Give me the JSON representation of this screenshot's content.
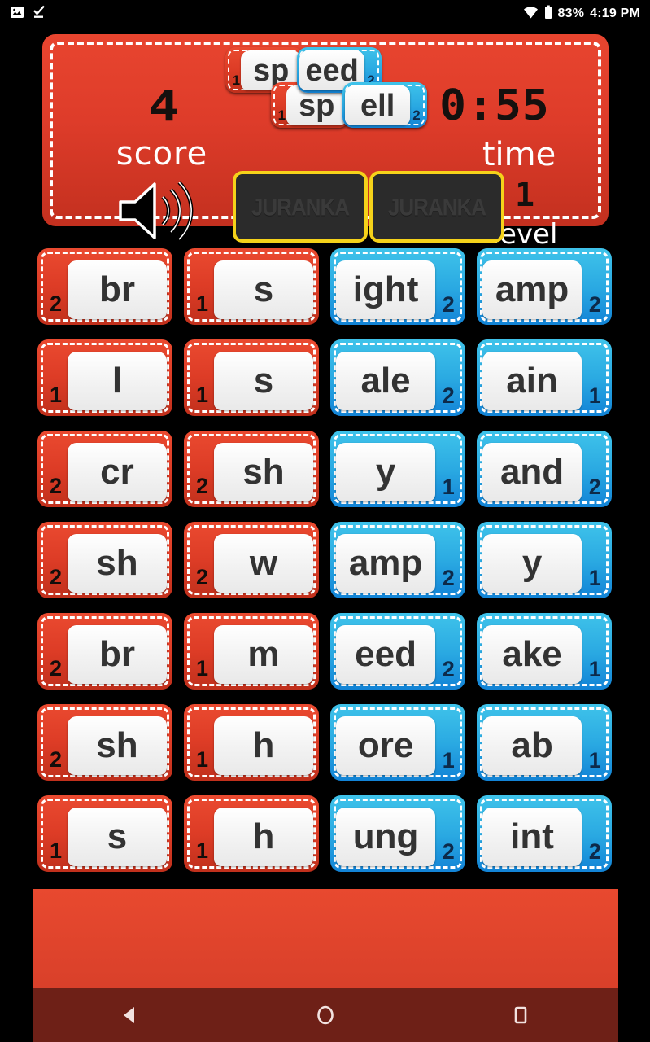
{
  "status_bar": {
    "icons_left": [
      "image-icon",
      "check-download-icon"
    ],
    "icons_right": [
      "wifi-icon",
      "battery-icon"
    ],
    "battery": "83%",
    "time": "4:19 PM"
  },
  "header": {
    "score_value": "4",
    "score_label": "score",
    "time_value": "0:55",
    "time_label": "time",
    "level_value": "1",
    "level_label": "level",
    "speaker_icon": "speaker-on-icon",
    "slots": [
      {
        "watermark": "JURANKA"
      },
      {
        "watermark": "JURANKA"
      }
    ]
  },
  "formed_words": [
    {
      "word": "speed",
      "parts": [
        {
          "text": "sp",
          "badge": "1",
          "color": "red"
        },
        {
          "text": "eed",
          "badge": "2",
          "color": "blue"
        }
      ]
    },
    {
      "word": "spell",
      "parts": [
        {
          "text": "sp",
          "badge": "1",
          "color": "red"
        },
        {
          "text": "ell",
          "badge": "2",
          "color": "blue"
        }
      ]
    }
  ],
  "tile_grid": {
    "columns": 4,
    "rows": 7,
    "tiles": [
      {
        "text": "br",
        "badge": "2",
        "color": "red"
      },
      {
        "text": "s",
        "badge": "1",
        "color": "red"
      },
      {
        "text": "ight",
        "badge": "2",
        "color": "blue"
      },
      {
        "text": "amp",
        "badge": "2",
        "color": "blue"
      },
      {
        "text": "l",
        "badge": "1",
        "color": "red"
      },
      {
        "text": "s",
        "badge": "1",
        "color": "red"
      },
      {
        "text": "ale",
        "badge": "2",
        "color": "blue"
      },
      {
        "text": "ain",
        "badge": "1",
        "color": "blue"
      },
      {
        "text": "cr",
        "badge": "2",
        "color": "red"
      },
      {
        "text": "sh",
        "badge": "2",
        "color": "red"
      },
      {
        "text": "y",
        "badge": "1",
        "color": "blue"
      },
      {
        "text": "and",
        "badge": "2",
        "color": "blue"
      },
      {
        "text": "sh",
        "badge": "2",
        "color": "red"
      },
      {
        "text": "w",
        "badge": "2",
        "color": "red"
      },
      {
        "text": "amp",
        "badge": "2",
        "color": "blue"
      },
      {
        "text": "y",
        "badge": "1",
        "color": "blue"
      },
      {
        "text": "br",
        "badge": "2",
        "color": "red"
      },
      {
        "text": "m",
        "badge": "1",
        "color": "red"
      },
      {
        "text": "eed",
        "badge": "2",
        "color": "blue"
      },
      {
        "text": "ake",
        "badge": "1",
        "color": "blue"
      },
      {
        "text": "sh",
        "badge": "2",
        "color": "red"
      },
      {
        "text": "h",
        "badge": "1",
        "color": "red"
      },
      {
        "text": "ore",
        "badge": "1",
        "color": "blue"
      },
      {
        "text": "ab",
        "badge": "1",
        "color": "blue"
      },
      {
        "text": "s",
        "badge": "1",
        "color": "red"
      },
      {
        "text": "h",
        "badge": "1",
        "color": "red"
      },
      {
        "text": "ung",
        "badge": "2",
        "color": "blue"
      },
      {
        "text": "int",
        "badge": "2",
        "color": "blue"
      }
    ]
  },
  "nav_bar": {
    "buttons": [
      "back-icon",
      "home-icon",
      "recents-icon"
    ]
  },
  "colors": {
    "red_tile_top": "#ea4a30",
    "red_tile_bottom": "#c0301c",
    "blue_tile_top": "#3fc3ea",
    "blue_tile_bottom": "#1283d6",
    "slot_border": "#f5d21a",
    "background": "#000000",
    "nav_bar": "#6e2017"
  }
}
